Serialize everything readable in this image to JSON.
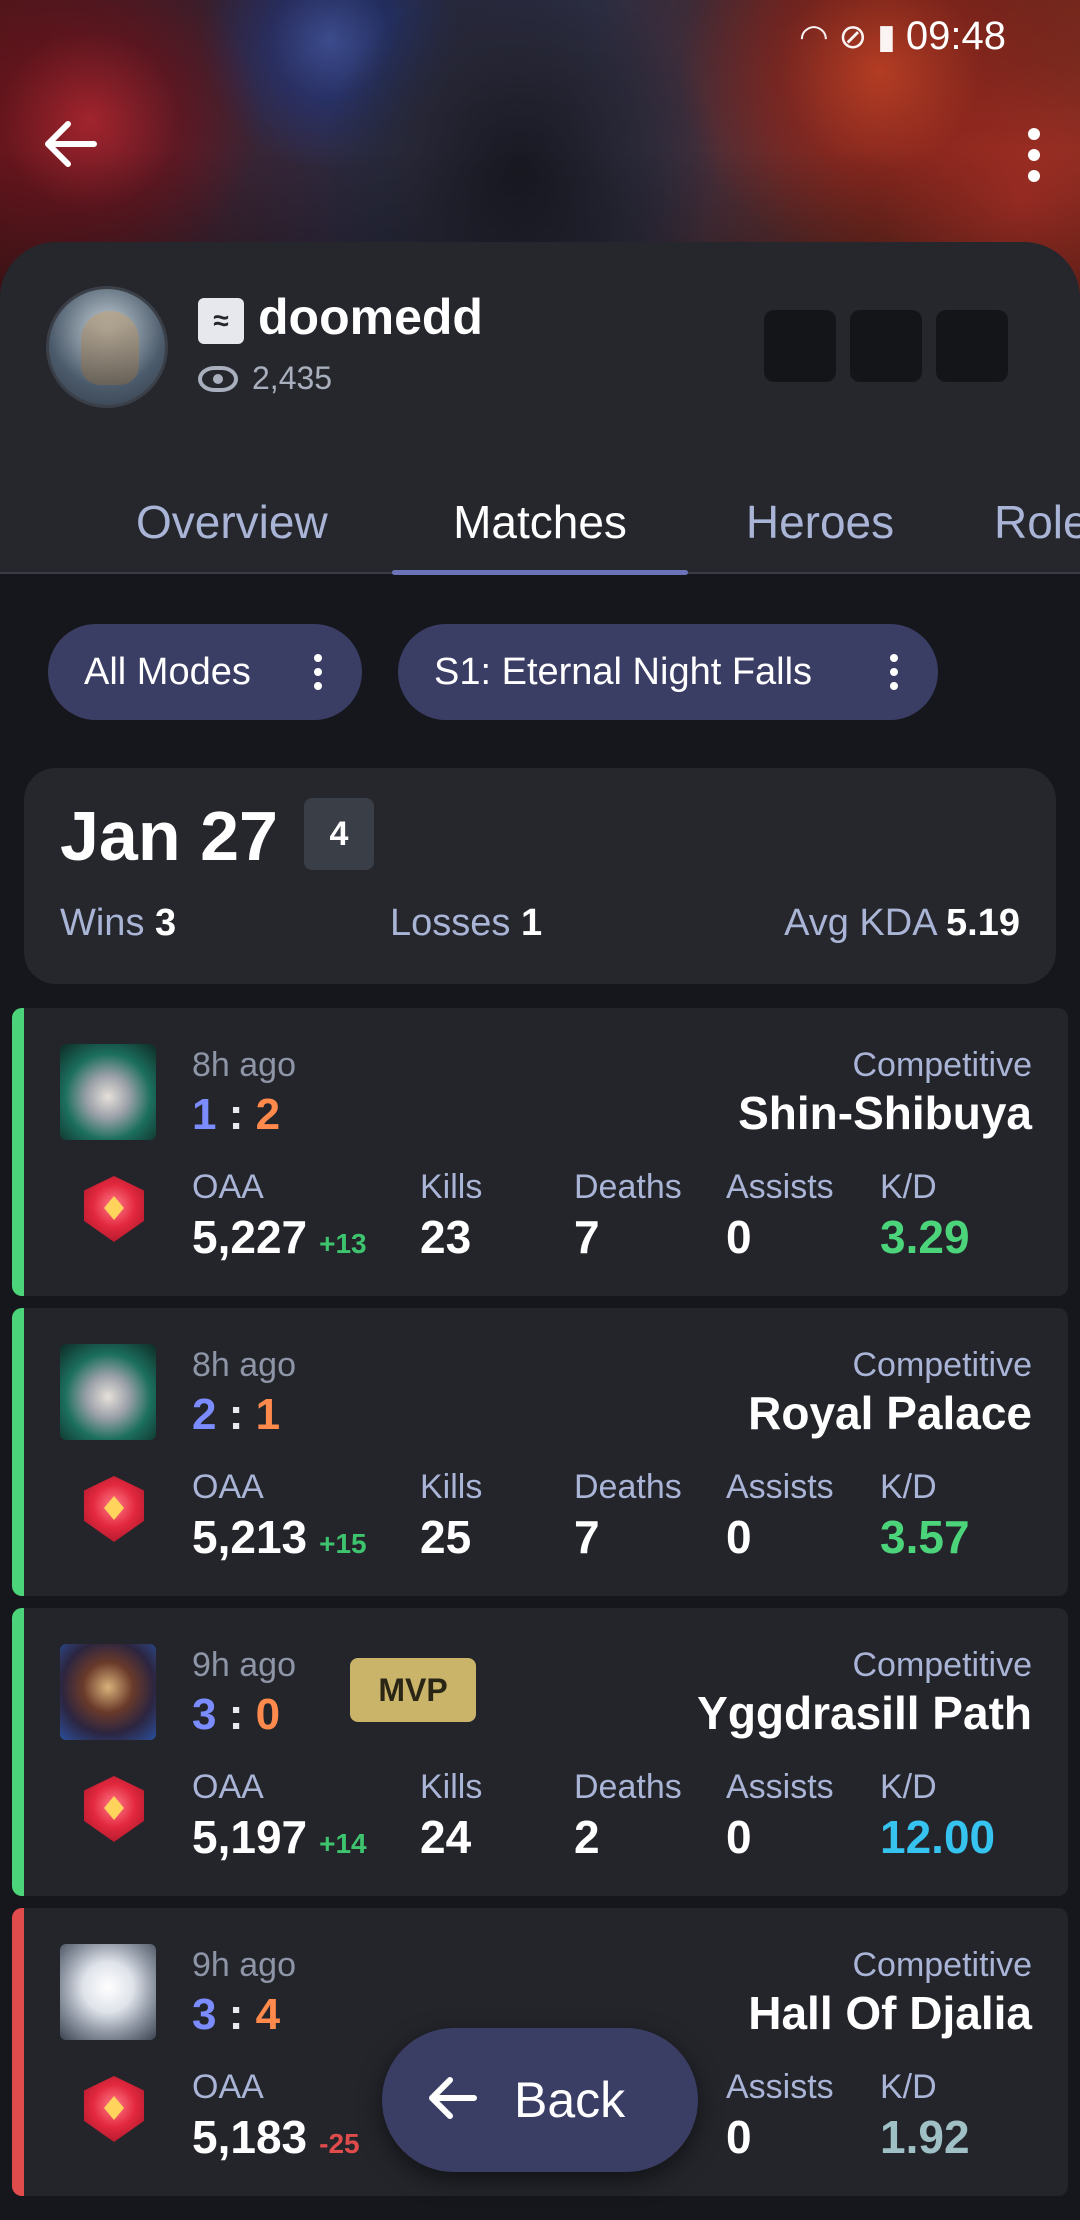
{
  "status": {
    "time": "09:48"
  },
  "profile": {
    "username": "doomedd",
    "views": "2,435"
  },
  "tabs": [
    "Overview",
    "Matches",
    "Heroes",
    "Role"
  ],
  "filters": [
    "All Modes",
    "S1: Eternal Night Falls"
  ],
  "summary": {
    "date": "Jan 27",
    "count": "4",
    "wins_label": "Wins",
    "wins": "3",
    "losses_label": "Losses",
    "losses": "1",
    "kda_label": "Avg KDA",
    "kda": "5.19"
  },
  "labels": {
    "oaa": "OAA",
    "kills": "Kills",
    "deaths": "Deaths",
    "assists": "Assists",
    "kd": "K/D",
    "mvp": "MVP"
  },
  "colors": {
    "win": "#4cd47a",
    "loss": "#e04b4b",
    "kd_good": "#4cd47a",
    "kd_great": "#36c3f0",
    "kd_neutral": "#9fc0c4"
  },
  "matches": [
    {
      "ago": "8h ago",
      "score_a": "1",
      "score_b": "2",
      "mode": "Competitive",
      "map": "Shin-Shibuya",
      "oaa": "5,227",
      "delta": "+13",
      "kills": "23",
      "deaths": "7",
      "assists": "0",
      "kd": "3.29",
      "result": "win",
      "mvp": false
    },
    {
      "ago": "8h ago",
      "score_a": "2",
      "score_b": "1",
      "mode": "Competitive",
      "map": "Royal Palace",
      "oaa": "5,213",
      "delta": "+15",
      "kills": "25",
      "deaths": "7",
      "assists": "0",
      "kd": "3.57",
      "result": "win",
      "mvp": false
    },
    {
      "ago": "9h ago",
      "score_a": "3",
      "score_b": "0",
      "mode": "Competitive",
      "map": "Yggdrasill Path",
      "oaa": "5,197",
      "delta": "+14",
      "kills": "24",
      "deaths": "2",
      "assists": "0",
      "kd": "12.00",
      "result": "win",
      "mvp": true
    },
    {
      "ago": "9h ago",
      "score_a": "3",
      "score_b": "4",
      "mode": "Competitive",
      "map": "Hall Of Djalia",
      "oaa": "5,183",
      "delta": "-25",
      "kills": "",
      "deaths": "",
      "assists": "0",
      "kd": "1.92",
      "result": "loss",
      "mvp": false
    }
  ],
  "fab": {
    "label": "Back"
  }
}
